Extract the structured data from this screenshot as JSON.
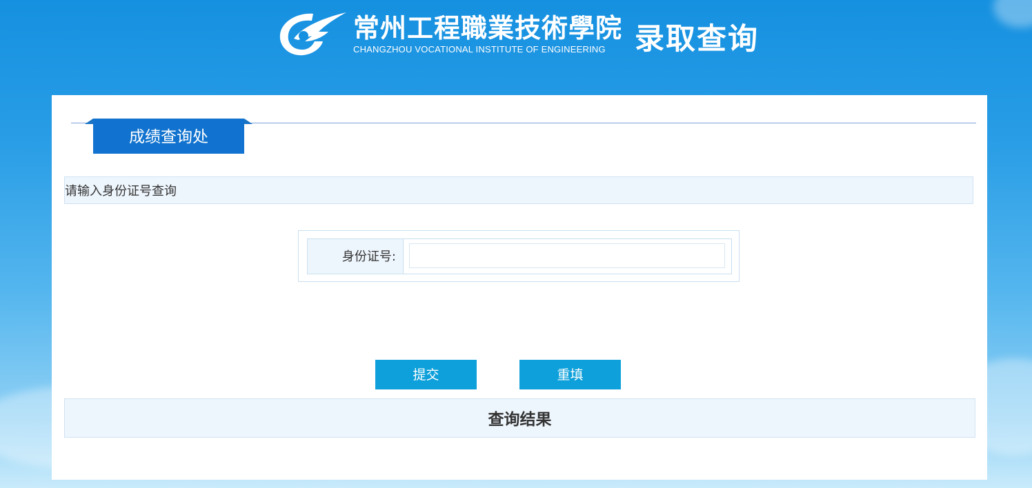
{
  "header": {
    "school_name_cn": "常州工程職業技術學院",
    "school_name_en": "CHANGZHOU VOCATIONAL INSTITUTE OF ENGINEERING",
    "page_title": "录取查询",
    "logo_icon": "college-logo-icon"
  },
  "panel": {
    "tab_label": "成绩查询处",
    "instruction": "请输入身份证号查询",
    "form": {
      "id_label": "身份证号:",
      "id_value": "",
      "id_placeholder": ""
    },
    "buttons": {
      "submit_label": "提交",
      "reset_label": "重填"
    },
    "result_heading": "查询结果"
  },
  "colors": {
    "accent_tab": "#1173cf",
    "button": "#0ea0da",
    "light_row": "#eef6fd"
  }
}
